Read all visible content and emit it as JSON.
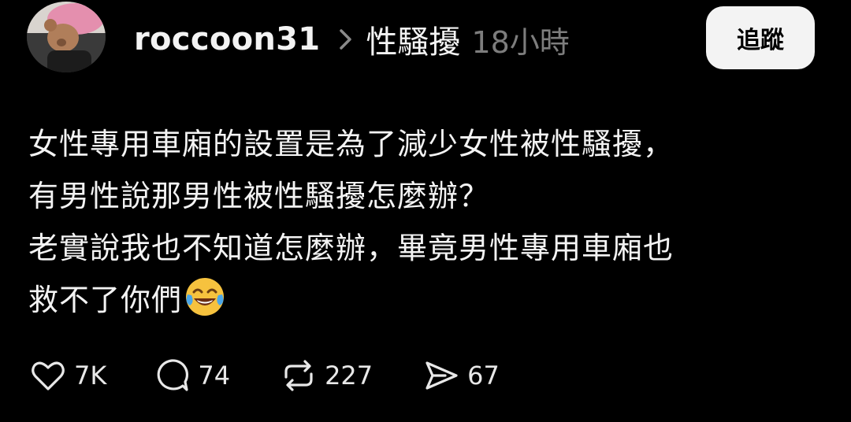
{
  "header": {
    "username": "roccoon31",
    "topic": "性騷擾",
    "time": "18小時",
    "follow_label": "追蹤"
  },
  "post": {
    "lines": [
      "女性專用車廂的設置是為了減少女性被性騷擾，",
      "有男性說那男性被性騷擾怎麼辦？",
      "老實說我也不知道怎麼辦，畢竟男性專用車廂也",
      "救不了你們"
    ],
    "emoji": "face-with-tears-of-joy"
  },
  "actions": {
    "likes": "7K",
    "replies": "74",
    "reposts": "227",
    "shares": "67"
  },
  "icons": {
    "like": "heart-icon",
    "reply": "comment-icon",
    "repost": "repost-icon",
    "share": "send-icon"
  }
}
